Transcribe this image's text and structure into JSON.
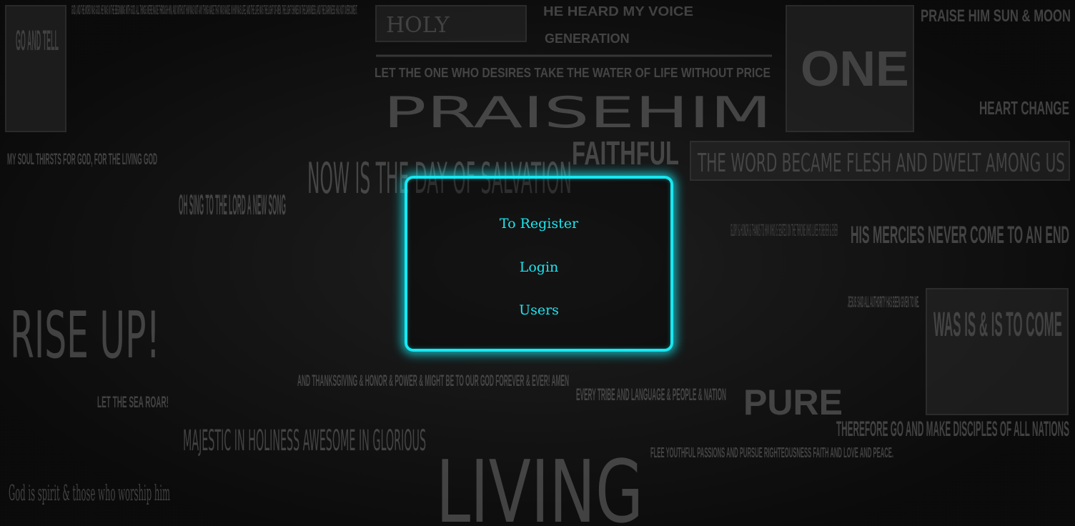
{
  "menu": {
    "register_label": "To Register",
    "login_label": "Login",
    "users_label": "Users"
  },
  "colors": {
    "accent": "#16e8f2",
    "background": "#111111"
  },
  "background_text": {
    "t1": "GO AND TELL",
    "t2": "GOD, AND THE WORD WAS GOD. HE WAS IN THE BEGINNING WITH GOD. ALL THINGS WERE MADE THROUGH HIM, AND WITHOUT HIM WAS NOT ANY THING MADE THAT WAS MADE. IN HIM WAS LIFE, AND THE LIFE WAS THE LIGHT OF MEN. THE LIGHT SHINES IN THE DARKNESS, AND THE DARKNESS HAS NOT OVERCOME IT.",
    "t3": "HOLY",
    "t4": "HE HEARD MY VOICE",
    "t5": "GENERATION",
    "t6": "LET THE ONE WHO DESIRES TAKE THE WATER OF LIFE WITHOUT PRICE",
    "t7": "PRAISEHIM",
    "t8": "ONE",
    "t9": "PRAISE HIM SUN & MOON",
    "t10": "HEART CHANGE",
    "t11": "MY SOUL THIRSTS FOR GOD, FOR THE LIVING GOD",
    "t12": "OH SING TO THE LORD A NEW SONG",
    "t13": "NOW IS THE DAY OF SALVATION",
    "t14": "FAITHFUL",
    "t15": "THE WORD BECAME FLESH AND DWELT AMONG US",
    "t16": "HIS MERCIES NEVER COME TO AN END",
    "t17": "RISE UP!",
    "t18": "JESUS SAID ALL AUTHORITY HAS BEEN GIVEN TO ME.",
    "t19": "WAS IS & IS TO COME",
    "t20": "AND THANKSGIVING & HONOR & POWER & MIGHT BE TO OUR GOD FOREVER & EVER! AMEN",
    "t21": "EVERY TRIBE AND LANGUAGE & PEOPLE & NATION",
    "t22": "MAJESTIC IN HOLINESS AWESOME IN GLORIOUS",
    "t23": "LIVING",
    "t24": "PURE",
    "t25": "FLEE YOUTHFUL PASSIONS AND PURSUE RIGHTEOUSNESS FAITH AND LOVE AND PEACE.",
    "t26": "THEREFORE GO AND MAKE DISCIPLES OF ALL NATIONS",
    "t27": "God is spirit & those who worship him",
    "t28": "GLORY & HONOR & THANKS TO HIM WHO IS SEATED ON THE THRONE WHO LIVES FOREVER & EVER",
    "t29": "LET THE SEA ROAR!"
  }
}
